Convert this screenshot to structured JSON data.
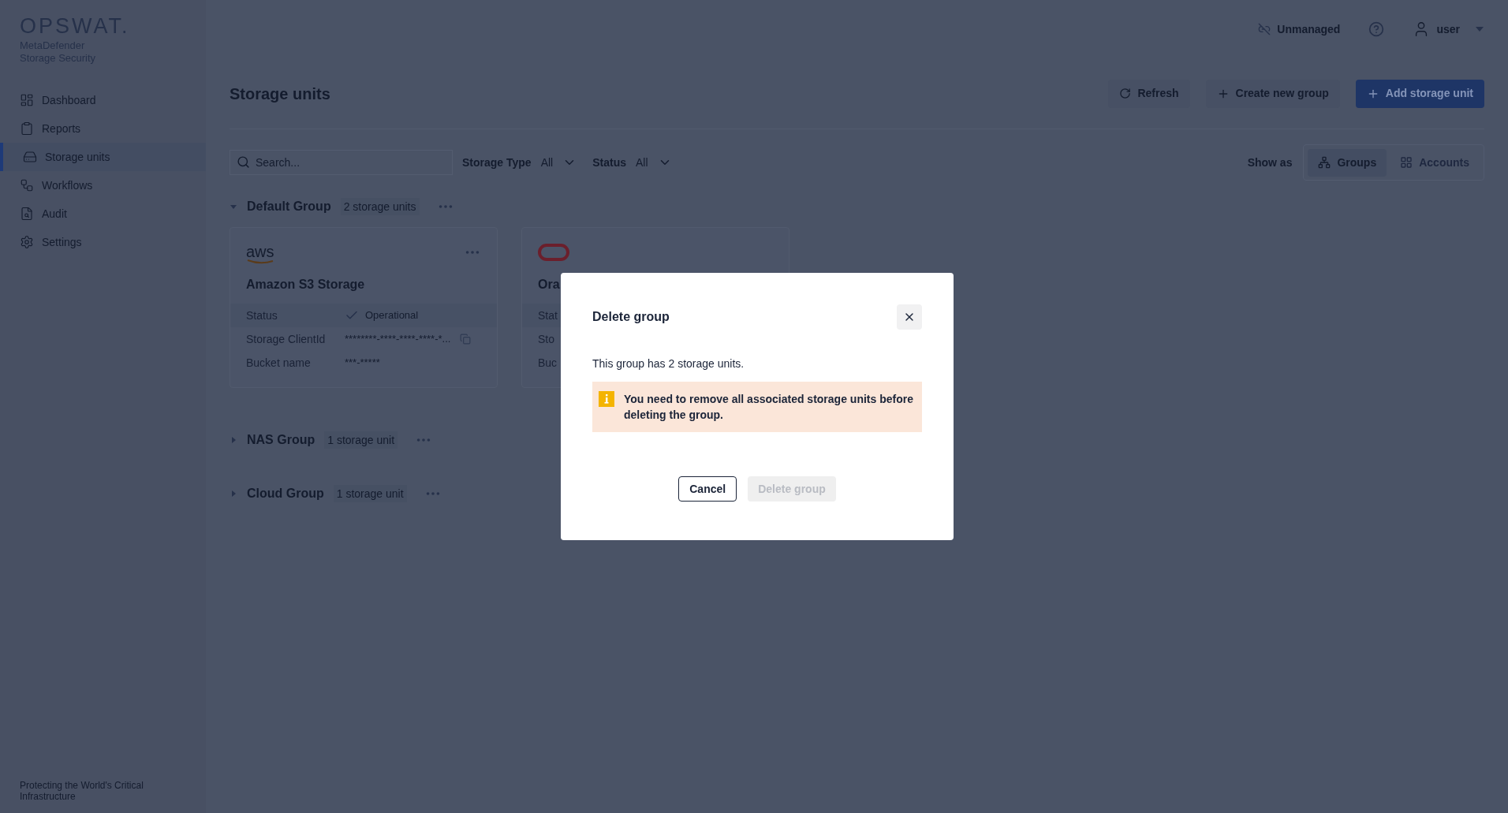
{
  "brand": {
    "logo": "OPSWAT.",
    "product_line1": "MetaDefender",
    "product_line2": "Storage Security",
    "tagline": "Protecting the World's Critical Infrastructure"
  },
  "sidebar": {
    "items": [
      {
        "label": "Dashboard",
        "selected": false
      },
      {
        "label": "Reports",
        "selected": false
      },
      {
        "label": "Storage units",
        "selected": true
      },
      {
        "label": "Workflows",
        "selected": false
      },
      {
        "label": "Audit",
        "selected": false
      },
      {
        "label": "Settings",
        "selected": false
      }
    ]
  },
  "top_bar": {
    "mode": "Unmanaged",
    "user": "user"
  },
  "page": {
    "title": "Storage units",
    "actions": [
      {
        "label": "Refresh",
        "kind": "refresh"
      },
      {
        "label": "Create new group",
        "kind": "secondary"
      },
      {
        "label": "Add storage unit",
        "kind": "primary"
      }
    ]
  },
  "filters": {
    "search_placeholder": "Search...",
    "storage_type_label": "Storage Type",
    "storage_type_value": "All",
    "status_label": "Status",
    "status_value": "All",
    "show_as_label": "Show as",
    "views": [
      {
        "label": "Groups",
        "selected": true
      },
      {
        "label": "Accounts",
        "selected": false
      }
    ]
  },
  "groups": [
    {
      "name": "Default Group",
      "count": "2 storage units",
      "expanded": true,
      "cards": [
        {
          "kind": "aws",
          "logo": "aws",
          "title": "Amazon S3 Storage",
          "rows": [
            {
              "label": "Status",
              "value": "Operational",
              "kind": "status"
            },
            {
              "label": "Storage ClientId",
              "value": "********-****-****-****-*...",
              "kind": "copy"
            },
            {
              "label": "Bucket name",
              "value": "***-*****",
              "kind": "plain"
            }
          ]
        },
        {
          "kind": "oracle",
          "title": "Ora",
          "rows": [
            {
              "label": "Stat",
              "kind": "status"
            },
            {
              "label": "Sto",
              "kind": "plain"
            },
            {
              "label": "Buc",
              "kind": "plain"
            }
          ]
        }
      ]
    },
    {
      "name": "NAS Group",
      "count": "1 storage unit",
      "expanded": false
    },
    {
      "name": "Cloud Group",
      "count": "1 storage unit",
      "expanded": false
    }
  ],
  "dialog": {
    "title": "Delete group",
    "message": "This group has 2 storage units.",
    "warning": "You need to remove all associated storage units before deleting the group.",
    "buttons": [
      {
        "label": "Cancel",
        "disabled": false
      },
      {
        "label": "Delete group",
        "disabled": true
      }
    ]
  }
}
